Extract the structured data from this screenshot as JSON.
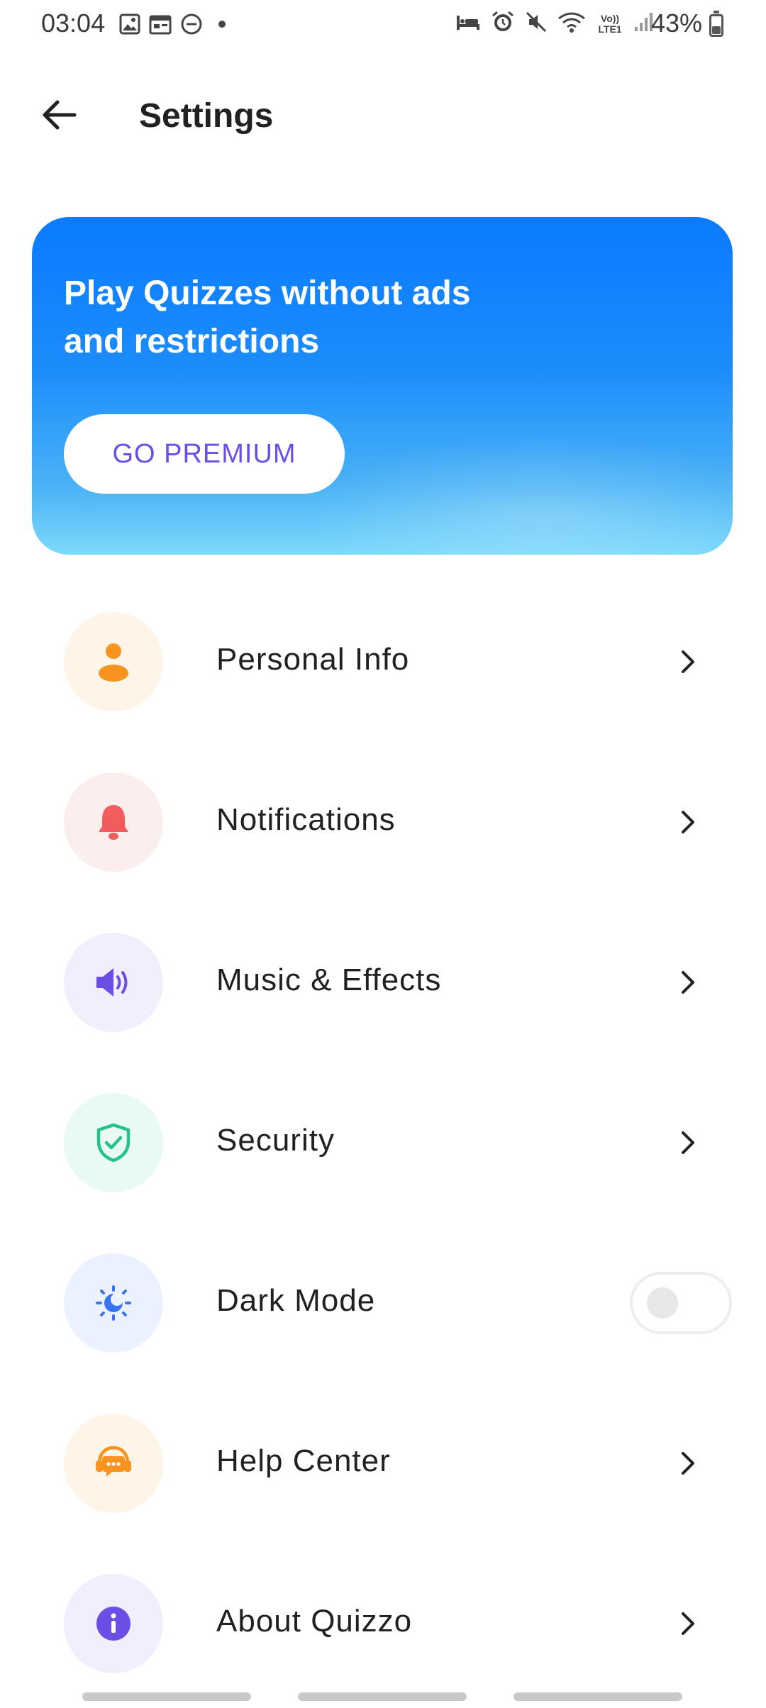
{
  "status_bar": {
    "time": "03:04",
    "left_icons": [
      "image-icon",
      "calendar-icon",
      "dnd-icon",
      "dot-icon"
    ],
    "right_icons": [
      "sleep-icon",
      "alarm-icon",
      "mute-icon",
      "wifi-icon",
      "volte-icon",
      "signal-icon"
    ],
    "volte_text": "Vo)) LTE1",
    "battery": "43%",
    "battery_level": 0.43
  },
  "app_bar": {
    "title": "Settings",
    "back_icon": "arrow-left-icon"
  },
  "banner": {
    "title": "Play Quizzes without ads and restrictions",
    "button_label": "GO PREMIUM"
  },
  "settings": [
    {
      "label": "Personal Info",
      "icon": "user-icon",
      "icon_color": "#f7931e",
      "icon_bg": "#fff4e8",
      "control": "chevron"
    },
    {
      "label": "Notifications",
      "icon": "bell-icon",
      "icon_color": "#f25c5c",
      "icon_bg": "#fdeeee",
      "control": "chevron"
    },
    {
      "label": "Music & Effects",
      "icon": "speaker-icon",
      "icon_color": "#6c4ee6",
      "icon_bg": "#f1eefd",
      "control": "chevron"
    },
    {
      "label": "Security",
      "icon": "shield-check-icon",
      "icon_color": "#23c38a",
      "icon_bg": "#e9f9f3",
      "control": "chevron"
    },
    {
      "label": "Dark Mode",
      "icon": "moon-sun-icon",
      "icon_color": "#3a73f0",
      "icon_bg": "#ebf1fe",
      "control": "toggle",
      "toggle_on": false
    },
    {
      "label": "Help Center",
      "icon": "headset-chat-icon",
      "icon_color": "#f7931e",
      "icon_bg": "#fff4e8",
      "control": "chevron"
    },
    {
      "label": "About Quizzo",
      "icon": "info-icon",
      "icon_color": "#6c4ee6",
      "icon_bg": "#f1eefd",
      "control": "chevron"
    }
  ],
  "colors": {
    "accent": "#6b4ee6",
    "banner_top": "#0a7bff",
    "banner_bottom": "#7dd9fb"
  }
}
